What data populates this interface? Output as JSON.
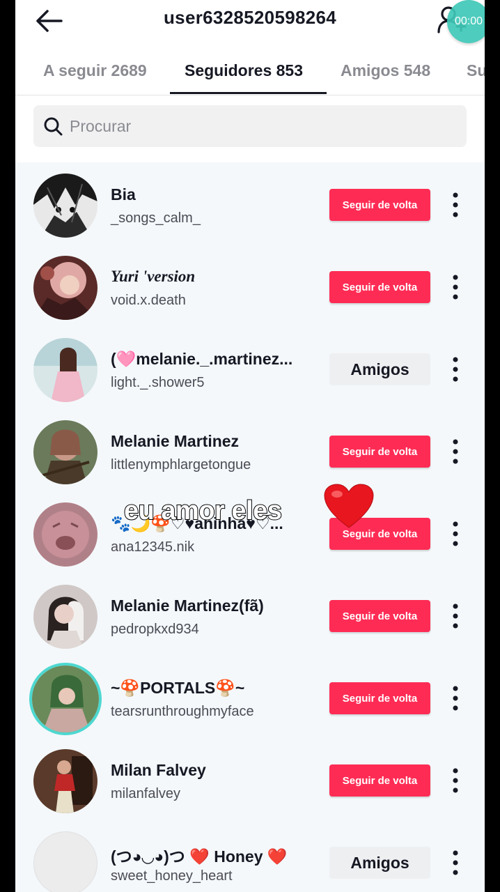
{
  "header": {
    "title": "user6328520598264",
    "timer": "00:00"
  },
  "tabs": [
    {
      "label": "A seguir 2689"
    },
    {
      "label": "Seguidores 853"
    },
    {
      "label": "Amigos 548"
    },
    {
      "label": "Su"
    }
  ],
  "search": {
    "placeholder": "Procurar"
  },
  "follow_button_label": "Seguir de volta",
  "friends_button_label": "Amigos",
  "users": [
    {
      "name": "Bia",
      "handle": "_songs_calm_",
      "button": "Seguir de volta"
    },
    {
      "name": "Yuri 'version",
      "handle": "void.x.death",
      "button": "Seguir de volta"
    },
    {
      "name": "(🩷melanie._.martinez...",
      "handle": "light._.shower5",
      "button": "Amigos"
    },
    {
      "name": "Melanie Martinez",
      "handle": "littlenymphlargetongue",
      "button": "Seguir de volta"
    },
    {
      "name": "🐾🌙🍄♡♥ahinha♥♡...",
      "handle": "ana12345.nik",
      "button": "Seguir de volta"
    },
    {
      "name": "Melanie Martinez(fã)",
      "handle": "pedropkxd934",
      "button": "Seguir de volta"
    },
    {
      "name": "~🍄PORTALS🍄~",
      "handle": "tearsrunthroughmyface",
      "button": "Seguir de volta"
    },
    {
      "name": "Milan Falvey",
      "handle": "milanfalvey",
      "button": "Seguir de volta"
    },
    {
      "name": "(つ◕◡◕)つ ❤️ Honey ❤️",
      "handle": "sweet_honey_heart",
      "button": "Amigos"
    }
  ],
  "overlay": {
    "caption": "eu amor eles"
  },
  "colors": {
    "accent": "#fe2c55",
    "text": "#161823",
    "muted": "#8a8b91"
  }
}
